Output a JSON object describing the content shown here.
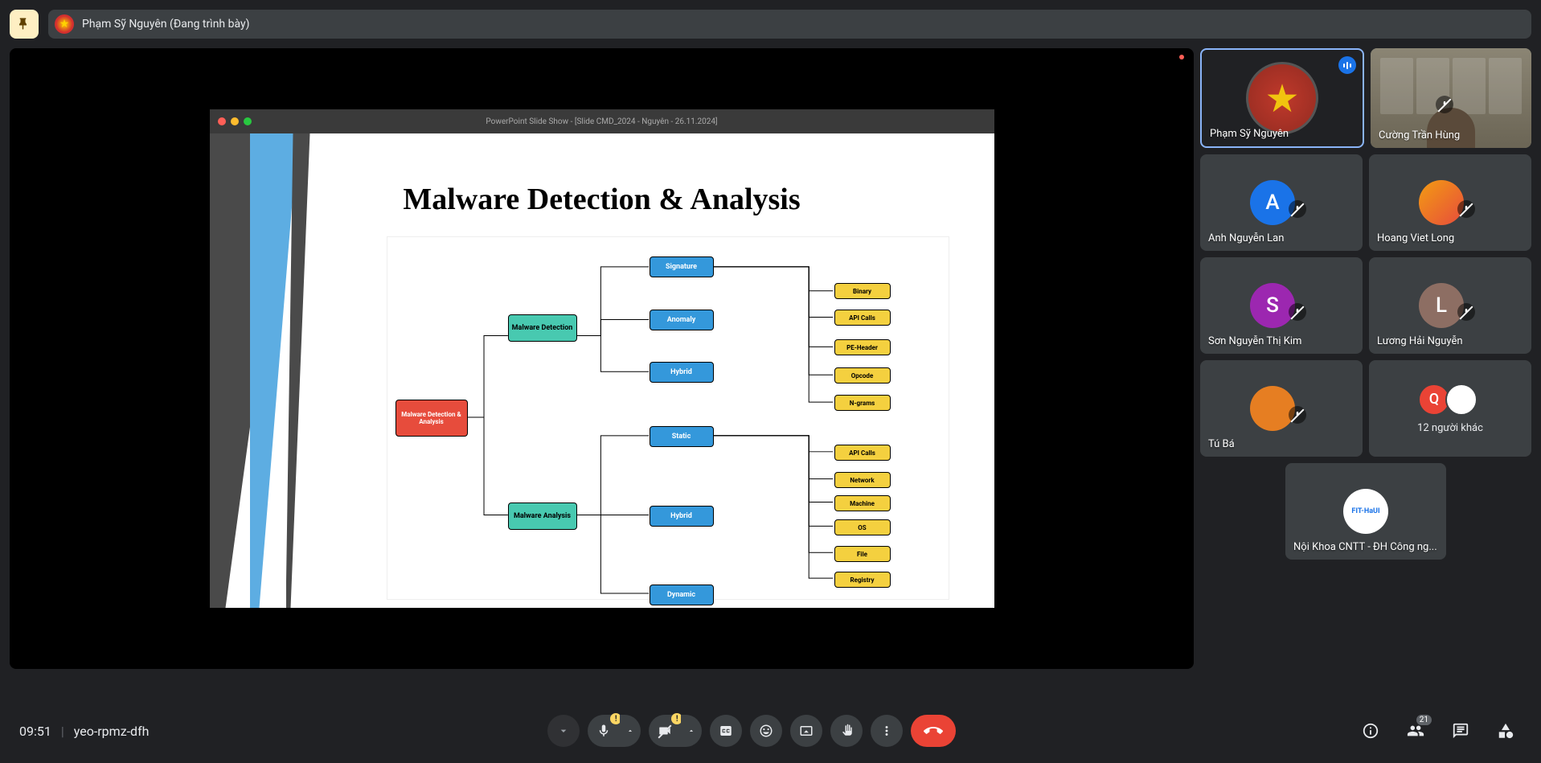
{
  "topbar": {
    "presenter_text": "Phạm Sỹ Nguyên (Đang trình bày)"
  },
  "slide": {
    "window_title": "PowerPoint Slide Show - [Slide CMD_2024 - Nguyên - 26.11.2024]",
    "title": "Malware Detection & Analysis",
    "nodes": {
      "root": "Malware Detection & Analysis",
      "detection": "Malware Detection",
      "analysis": "Malware Analysis",
      "signature": "Signature",
      "anomaly": "Anomaly",
      "hybrid1": "Hybrid",
      "static": "Static",
      "hybrid2": "Hybrid",
      "dynamic": "Dynamic",
      "binary": "Binary",
      "apicalls1": "API Calls",
      "peheader": "PE-Header",
      "opcode": "Opcode",
      "ngrams": "N-grams",
      "apicalls2": "API Calls",
      "network": "Network",
      "machine": "Machine",
      "os": "OS",
      "file": "File",
      "registry": "Registry"
    }
  },
  "participants": {
    "p1": "Phạm Sỹ Nguyên",
    "p2": "Cường Trần Hùng",
    "p3": "Anh Nguyễn Lan",
    "p4": "Hoang Viet Long",
    "p5": "Sơn Nguyễn Thị Kim",
    "p6": "Lương Hải Nguyễn",
    "p7": "Tú Bá",
    "overflow": "12 người khác",
    "p8": "Nội Khoa CNTT - ĐH Công ng...",
    "avatar_a": "A",
    "avatar_s": "S",
    "avatar_l": "L",
    "avatar_q": "Q",
    "logo": "FIT-HaUI"
  },
  "bottom": {
    "time": "09:51",
    "code": "yeo-rpmz-dfh",
    "participant_count": "21",
    "warn": "!"
  }
}
